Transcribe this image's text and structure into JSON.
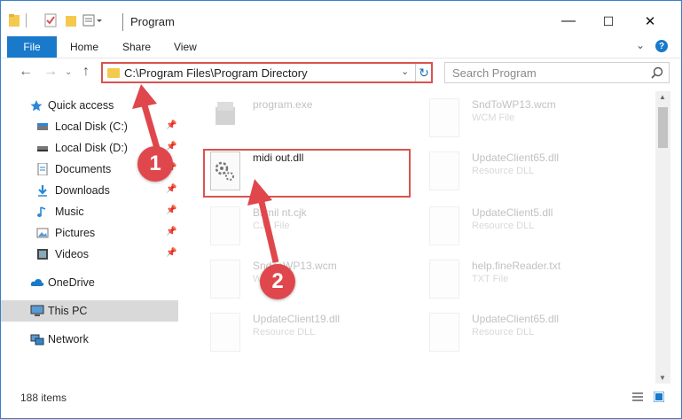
{
  "window": {
    "title": "Program",
    "controls": {
      "minimize": "—",
      "maximize": "☐",
      "close": "✕"
    }
  },
  "ribbon": {
    "file_tab": "File",
    "tabs": [
      "Home",
      "Share",
      "View"
    ],
    "help_label": "?"
  },
  "nav": {
    "address": "C:\\Program Files\\Program Directory",
    "search_placeholder": "Search Program"
  },
  "sidebar": {
    "quick_access": "Quick access",
    "items": [
      {
        "label": "Local Disk (C:)",
        "icon": "drive-icon",
        "pinned": true
      },
      {
        "label": "Local Disk (D:)",
        "icon": "drive-icon",
        "pinned": true
      },
      {
        "label": "Documents",
        "icon": "documents-icon",
        "pinned": true
      },
      {
        "label": "Downloads",
        "icon": "downloads-icon",
        "pinned": true
      },
      {
        "label": "Music",
        "icon": "music-icon",
        "pinned": true
      },
      {
        "label": "Pictures",
        "icon": "pictures-icon",
        "pinned": true
      },
      {
        "label": "Videos",
        "icon": "videos-icon",
        "pinned": true
      }
    ],
    "onedrive": "OneDrive",
    "this_pc": "This PC",
    "network": "Network"
  },
  "files": [
    {
      "name": "program.exe",
      "desc": "",
      "faded": true
    },
    {
      "name": "midi out.dll",
      "desc": "",
      "faded": false
    },
    {
      "name": "Bsmil nt.cjk",
      "desc": "CJK File",
      "faded": true
    },
    {
      "name": "SndToWP13.wcm",
      "desc": "WCM File",
      "faded": true
    },
    {
      "name": "UpdateClient19.dll",
      "desc": "Resource DLL",
      "faded": true
    },
    {
      "name": "SndToWP13.wcm",
      "desc": "WCM File",
      "faded": true
    },
    {
      "name": "UpdateClient65.dll",
      "desc": "Resource DLL",
      "faded": true
    },
    {
      "name": "UpdateClient5.dll",
      "desc": "Resource DLL",
      "faded": true
    },
    {
      "name": "help.fineReader.txt",
      "desc": "TXT File",
      "faded": true
    },
    {
      "name": "UpdateClient65.dll",
      "desc": "Resource DLL",
      "faded": true
    }
  ],
  "status": {
    "item_count": "188 items"
  },
  "annotations": {
    "step1": "1",
    "step2": "2"
  },
  "colors": {
    "accent": "#1979ca",
    "highlight": "#d9534f",
    "badge": "#e0474c",
    "folder": "#f4c94e"
  }
}
